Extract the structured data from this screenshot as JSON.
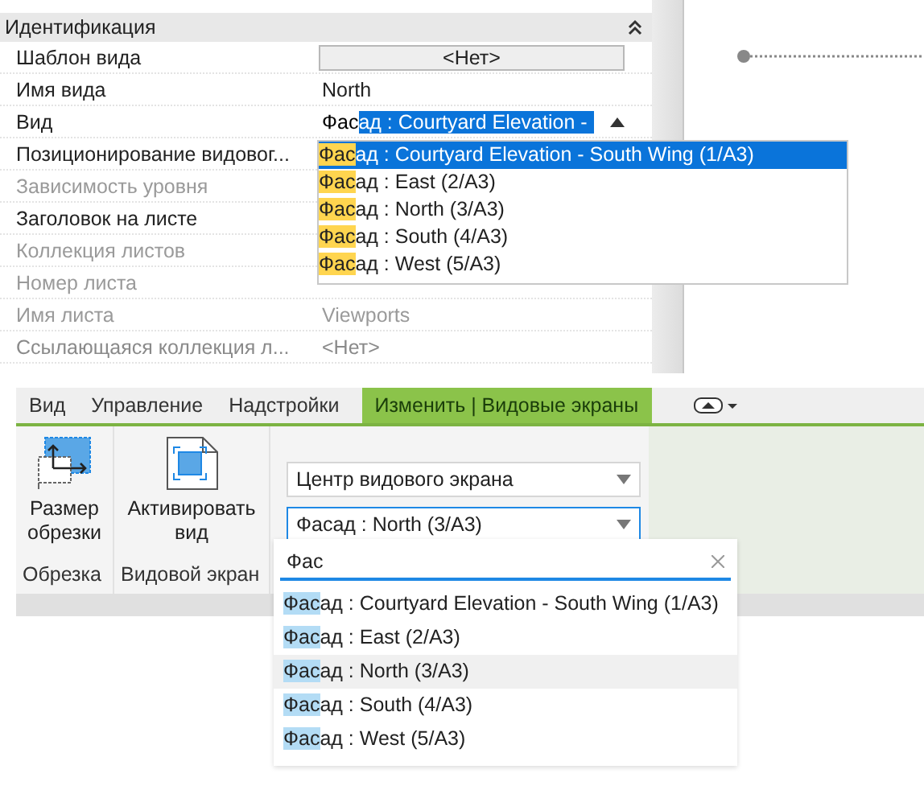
{
  "properties": {
    "group": "Идентификация",
    "rows": [
      {
        "label": "Шаблон вида",
        "kind": "button",
        "value": "<Нет>",
        "disabled": false
      },
      {
        "label": "Имя вида",
        "kind": "text",
        "value": "North",
        "disabled": false
      },
      {
        "label": "Вид",
        "kind": "combo",
        "value": "Фас",
        "selection": "ад : Courtyard Elevation -",
        "disabled": false
      },
      {
        "label": "Позиционирование видовог...",
        "kind": "text",
        "disabled": false
      },
      {
        "label": "Зависимость уровня",
        "kind": "text",
        "disabled": true
      },
      {
        "label": "Заголовок на листе",
        "kind": "text",
        "disabled": false
      },
      {
        "label": "Коллекция листов",
        "kind": "text",
        "disabled": true
      },
      {
        "label": "Номер листа",
        "kind": "text",
        "disabled": true
      },
      {
        "label": "Имя листа",
        "kind": "text",
        "value": "Viewports",
        "disabled": true
      },
      {
        "label": "Ссылающаяся коллекция л...",
        "kind": "text",
        "value": "<Нет>",
        "disabled": true
      }
    ],
    "view_list": [
      {
        "match": "Фас",
        "rest": "ад : Courtyard Elevation - South Wing (1/A3)",
        "selected": true
      },
      {
        "match": "Фас",
        "rest": "ад : East (2/A3)",
        "selected": false
      },
      {
        "match": "Фас",
        "rest": "ад : North (3/A3)",
        "selected": false
      },
      {
        "match": "Фас",
        "rest": "ад : South (4/A3)",
        "selected": false
      },
      {
        "match": "Фас",
        "rest": "ад : West (5/A3)",
        "selected": false
      }
    ]
  },
  "ribbon": {
    "tabs": [
      {
        "label": "Вид",
        "selected": false
      },
      {
        "label": "Управление",
        "selected": false
      },
      {
        "label": "Надстройки",
        "selected": false
      },
      {
        "label": "Изменить | Видовые экраны",
        "selected": true
      }
    ],
    "panels": [
      {
        "title": "Обрезка",
        "button": "Размер обрезки",
        "kind": "crop"
      },
      {
        "title": "Видовой экран",
        "button": "Активировать вид",
        "kind": "activate"
      }
    ],
    "combos": [
      {
        "value": "Центр видового экрана",
        "focused": false
      },
      {
        "value": "Фасад : North (3/A3)",
        "focused": true
      }
    ],
    "search": {
      "value": "Фас"
    },
    "results": [
      {
        "match": "Фас",
        "rest": "ад : Courtyard Elevation - South Wing (1/A3)",
        "selected": false
      },
      {
        "match": "Фас",
        "rest": "ад : East (2/A3)",
        "selected": false
      },
      {
        "match": "Фас",
        "rest": "ад : North (3/A3)",
        "selected": true
      },
      {
        "match": "Фас",
        "rest": "ад : South (4/A3)",
        "selected": false
      },
      {
        "match": "Фас",
        "rest": "ад : West (5/A3)",
        "selected": false
      }
    ]
  }
}
